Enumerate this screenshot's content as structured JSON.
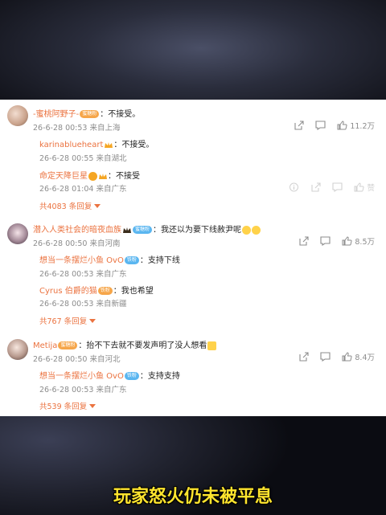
{
  "threads": [
    {
      "user": "-蜜桃阿野子-",
      "badge": "蜜糖粉",
      "sep": "：",
      "text": "不接受。",
      "meta": "26-6-28 00:53 来自上海",
      "likes": "11.2万",
      "replies": [
        {
          "user": "karinablueheart",
          "sep": "：",
          "text": "不接受。",
          "meta": "26-6-28 00:55 来自湖北"
        },
        {
          "user": "命定天降巨星",
          "sep": "：",
          "text": "不接受",
          "meta": "26-6-28 01:04 来自广东"
        }
      ],
      "sub_likes": "赞",
      "more": "共4083 条回复"
    },
    {
      "user": "潜入人类社会的暗夜血族",
      "badge": "蜜糖粉",
      "sep": "：",
      "text": "我还以为要下线赦尹呢",
      "meta": "26-6-28 00:50 来自河南",
      "likes": "8.5万",
      "replies": [
        {
          "user": "想当一条摆烂小鱼 OvO",
          "badge": "铁粉",
          "sep": "：",
          "text": "支持下线",
          "meta": "26-6-28 00:53 来自广东"
        },
        {
          "user": "Cyrus 伯爵的猫",
          "badge": "铁粉",
          "sep": "：",
          "text": "我也希望",
          "meta": "26-6-28 00:53 来自新疆"
        }
      ],
      "more": "共767 条回复"
    },
    {
      "user": "Metija",
      "badge": "蜜糖粉",
      "sep": "：",
      "text": "抬不下去就不要发声明了没人想看",
      "meta": "26-6-28 00:50 来自河北",
      "likes": "8.4万",
      "replies": [
        {
          "user": "想当一条摆烂小鱼 OvO",
          "badge": "铁粉",
          "sep": "：",
          "text": "支持支持",
          "meta": "26-6-28 00:53 来自广东"
        }
      ],
      "more": "共539 条回复"
    }
  ],
  "subtitle": "玩家怒火仍未被平息",
  "icons": [
    "share-icon",
    "comment-icon",
    "thumbs-up-icon",
    "chevron-down-icon",
    "info-icon"
  ],
  "colors": {
    "username": "#eb7340",
    "meta": "#8c8c8c",
    "subtitle": "#ffe52e"
  }
}
